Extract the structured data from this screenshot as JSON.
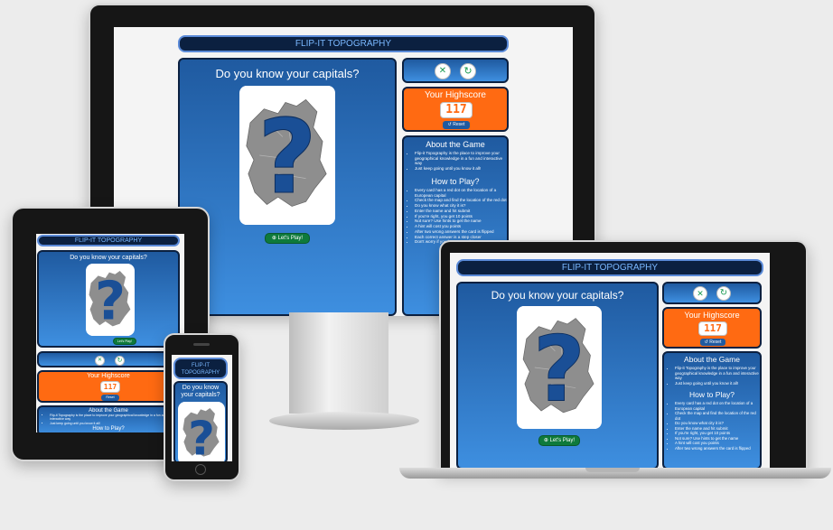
{
  "app": {
    "title": "FLIP-IT TOPOGRAPHY",
    "title_phone": "FLIP-IT TOPOGRAPHY",
    "question": "Do you know your capitals?",
    "play_label": "Let's Play!",
    "colors": {
      "accent_blue": "#1f5aa0",
      "highscore_orange": "#ff6a12",
      "play_green": "#0e7a3b",
      "header_navy": "#0b2040"
    },
    "icons": {
      "mute": "speaker-mute-icon",
      "restart": "restart-icon",
      "reset": "reset-icon",
      "play": "play-icon"
    }
  },
  "highscore": {
    "title": "Your Highscore",
    "value": "117",
    "reset_label": "Reset"
  },
  "about": {
    "title": "About the Game",
    "items": [
      "Flip-it Topography is the place to improve your geographical knowledge in a fun and interactive way",
      "Just keep going until you know it all!"
    ]
  },
  "howto": {
    "title": "How to Play?",
    "items": [
      "Every card has a red dot on the location of a European capital",
      "Check the map and find the location of the red dot",
      "Do you know what city it is?",
      "Enter the name and hit submit",
      "If you're right, you get 10 points",
      "Not sure? Use hints to get the name",
      "A hint will cost you points",
      "After two wrong answers the card is flipped",
      "Each correct answer is a step closer",
      "Don't worry if you have to spell it"
    ]
  }
}
